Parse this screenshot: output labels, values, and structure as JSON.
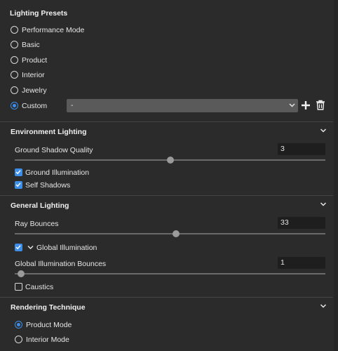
{
  "lighting_presets": {
    "title": "Lighting Presets",
    "options": [
      {
        "label": "Performance Mode",
        "selected": false
      },
      {
        "label": "Basic",
        "selected": false
      },
      {
        "label": "Product",
        "selected": false
      },
      {
        "label": "Interior",
        "selected": false
      },
      {
        "label": "Jewelry",
        "selected": false
      },
      {
        "label": "Custom",
        "selected": true
      }
    ],
    "custom_dropdown_value": "-",
    "add_icon": "plus-icon",
    "delete_icon": "trash-icon"
  },
  "environment_lighting": {
    "title": "Environment Lighting",
    "ground_shadow_quality_label": "Ground Shadow Quality",
    "ground_shadow_quality_value": "3",
    "ground_shadow_quality_slider": 0.5,
    "ground_illumination_label": "Ground Illumination",
    "ground_illumination_checked": true,
    "self_shadows_label": "Self Shadows",
    "self_shadows_checked": true
  },
  "general_lighting": {
    "title": "General Lighting",
    "ray_bounces_label": "Ray Bounces",
    "ray_bounces_value": "33",
    "ray_bounces_slider": 0.52,
    "global_illumination_label": "Global Illumination",
    "global_illumination_checked": true,
    "gi_bounces_label": "Global Illumination Bounces",
    "gi_bounces_value": "1",
    "gi_bounces_slider": 0.02,
    "caustics_label": "Caustics",
    "caustics_checked": false
  },
  "rendering_technique": {
    "title": "Rendering Technique",
    "options": [
      {
        "label": "Product Mode",
        "selected": true
      },
      {
        "label": "Interior Mode",
        "selected": false
      }
    ]
  },
  "colors": {
    "accent": "#3d8ee8",
    "background": "#2b2b2b"
  }
}
